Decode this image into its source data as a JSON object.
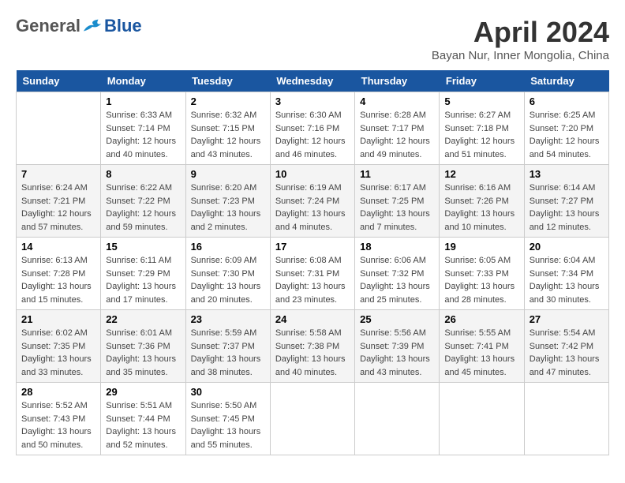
{
  "header": {
    "logo": {
      "general": "General",
      "blue": "Blue",
      "tagline": ""
    },
    "title": "April 2024",
    "location": "Bayan Nur, Inner Mongolia, China"
  },
  "weekdays": [
    "Sunday",
    "Monday",
    "Tuesday",
    "Wednesday",
    "Thursday",
    "Friday",
    "Saturday"
  ],
  "weeks": [
    [
      {
        "day": "",
        "sunrise": "",
        "sunset": "",
        "daylight": ""
      },
      {
        "day": "1",
        "sunrise": "Sunrise: 6:33 AM",
        "sunset": "Sunset: 7:14 PM",
        "daylight": "Daylight: 12 hours and 40 minutes."
      },
      {
        "day": "2",
        "sunrise": "Sunrise: 6:32 AM",
        "sunset": "Sunset: 7:15 PM",
        "daylight": "Daylight: 12 hours and 43 minutes."
      },
      {
        "day": "3",
        "sunrise": "Sunrise: 6:30 AM",
        "sunset": "Sunset: 7:16 PM",
        "daylight": "Daylight: 12 hours and 46 minutes."
      },
      {
        "day": "4",
        "sunrise": "Sunrise: 6:28 AM",
        "sunset": "Sunset: 7:17 PM",
        "daylight": "Daylight: 12 hours and 49 minutes."
      },
      {
        "day": "5",
        "sunrise": "Sunrise: 6:27 AM",
        "sunset": "Sunset: 7:18 PM",
        "daylight": "Daylight: 12 hours and 51 minutes."
      },
      {
        "day": "6",
        "sunrise": "Sunrise: 6:25 AM",
        "sunset": "Sunset: 7:20 PM",
        "daylight": "Daylight: 12 hours and 54 minutes."
      }
    ],
    [
      {
        "day": "7",
        "sunrise": "Sunrise: 6:24 AM",
        "sunset": "Sunset: 7:21 PM",
        "daylight": "Daylight: 12 hours and 57 minutes."
      },
      {
        "day": "8",
        "sunrise": "Sunrise: 6:22 AM",
        "sunset": "Sunset: 7:22 PM",
        "daylight": "Daylight: 12 hours and 59 minutes."
      },
      {
        "day": "9",
        "sunrise": "Sunrise: 6:20 AM",
        "sunset": "Sunset: 7:23 PM",
        "daylight": "Daylight: 13 hours and 2 minutes."
      },
      {
        "day": "10",
        "sunrise": "Sunrise: 6:19 AM",
        "sunset": "Sunset: 7:24 PM",
        "daylight": "Daylight: 13 hours and 4 minutes."
      },
      {
        "day": "11",
        "sunrise": "Sunrise: 6:17 AM",
        "sunset": "Sunset: 7:25 PM",
        "daylight": "Daylight: 13 hours and 7 minutes."
      },
      {
        "day": "12",
        "sunrise": "Sunrise: 6:16 AM",
        "sunset": "Sunset: 7:26 PM",
        "daylight": "Daylight: 13 hours and 10 minutes."
      },
      {
        "day": "13",
        "sunrise": "Sunrise: 6:14 AM",
        "sunset": "Sunset: 7:27 PM",
        "daylight": "Daylight: 13 hours and 12 minutes."
      }
    ],
    [
      {
        "day": "14",
        "sunrise": "Sunrise: 6:13 AM",
        "sunset": "Sunset: 7:28 PM",
        "daylight": "Daylight: 13 hours and 15 minutes."
      },
      {
        "day": "15",
        "sunrise": "Sunrise: 6:11 AM",
        "sunset": "Sunset: 7:29 PM",
        "daylight": "Daylight: 13 hours and 17 minutes."
      },
      {
        "day": "16",
        "sunrise": "Sunrise: 6:09 AM",
        "sunset": "Sunset: 7:30 PM",
        "daylight": "Daylight: 13 hours and 20 minutes."
      },
      {
        "day": "17",
        "sunrise": "Sunrise: 6:08 AM",
        "sunset": "Sunset: 7:31 PM",
        "daylight": "Daylight: 13 hours and 23 minutes."
      },
      {
        "day": "18",
        "sunrise": "Sunrise: 6:06 AM",
        "sunset": "Sunset: 7:32 PM",
        "daylight": "Daylight: 13 hours and 25 minutes."
      },
      {
        "day": "19",
        "sunrise": "Sunrise: 6:05 AM",
        "sunset": "Sunset: 7:33 PM",
        "daylight": "Daylight: 13 hours and 28 minutes."
      },
      {
        "day": "20",
        "sunrise": "Sunrise: 6:04 AM",
        "sunset": "Sunset: 7:34 PM",
        "daylight": "Daylight: 13 hours and 30 minutes."
      }
    ],
    [
      {
        "day": "21",
        "sunrise": "Sunrise: 6:02 AM",
        "sunset": "Sunset: 7:35 PM",
        "daylight": "Daylight: 13 hours and 33 minutes."
      },
      {
        "day": "22",
        "sunrise": "Sunrise: 6:01 AM",
        "sunset": "Sunset: 7:36 PM",
        "daylight": "Daylight: 13 hours and 35 minutes."
      },
      {
        "day": "23",
        "sunrise": "Sunrise: 5:59 AM",
        "sunset": "Sunset: 7:37 PM",
        "daylight": "Daylight: 13 hours and 38 minutes."
      },
      {
        "day": "24",
        "sunrise": "Sunrise: 5:58 AM",
        "sunset": "Sunset: 7:38 PM",
        "daylight": "Daylight: 13 hours and 40 minutes."
      },
      {
        "day": "25",
        "sunrise": "Sunrise: 5:56 AM",
        "sunset": "Sunset: 7:39 PM",
        "daylight": "Daylight: 13 hours and 43 minutes."
      },
      {
        "day": "26",
        "sunrise": "Sunrise: 5:55 AM",
        "sunset": "Sunset: 7:41 PM",
        "daylight": "Daylight: 13 hours and 45 minutes."
      },
      {
        "day": "27",
        "sunrise": "Sunrise: 5:54 AM",
        "sunset": "Sunset: 7:42 PM",
        "daylight": "Daylight: 13 hours and 47 minutes."
      }
    ],
    [
      {
        "day": "28",
        "sunrise": "Sunrise: 5:52 AM",
        "sunset": "Sunset: 7:43 PM",
        "daylight": "Daylight: 13 hours and 50 minutes."
      },
      {
        "day": "29",
        "sunrise": "Sunrise: 5:51 AM",
        "sunset": "Sunset: 7:44 PM",
        "daylight": "Daylight: 13 hours and 52 minutes."
      },
      {
        "day": "30",
        "sunrise": "Sunrise: 5:50 AM",
        "sunset": "Sunset: 7:45 PM",
        "daylight": "Daylight: 13 hours and 55 minutes."
      },
      {
        "day": "",
        "sunrise": "",
        "sunset": "",
        "daylight": ""
      },
      {
        "day": "",
        "sunrise": "",
        "sunset": "",
        "daylight": ""
      },
      {
        "day": "",
        "sunrise": "",
        "sunset": "",
        "daylight": ""
      },
      {
        "day": "",
        "sunrise": "",
        "sunset": "",
        "daylight": ""
      }
    ]
  ]
}
